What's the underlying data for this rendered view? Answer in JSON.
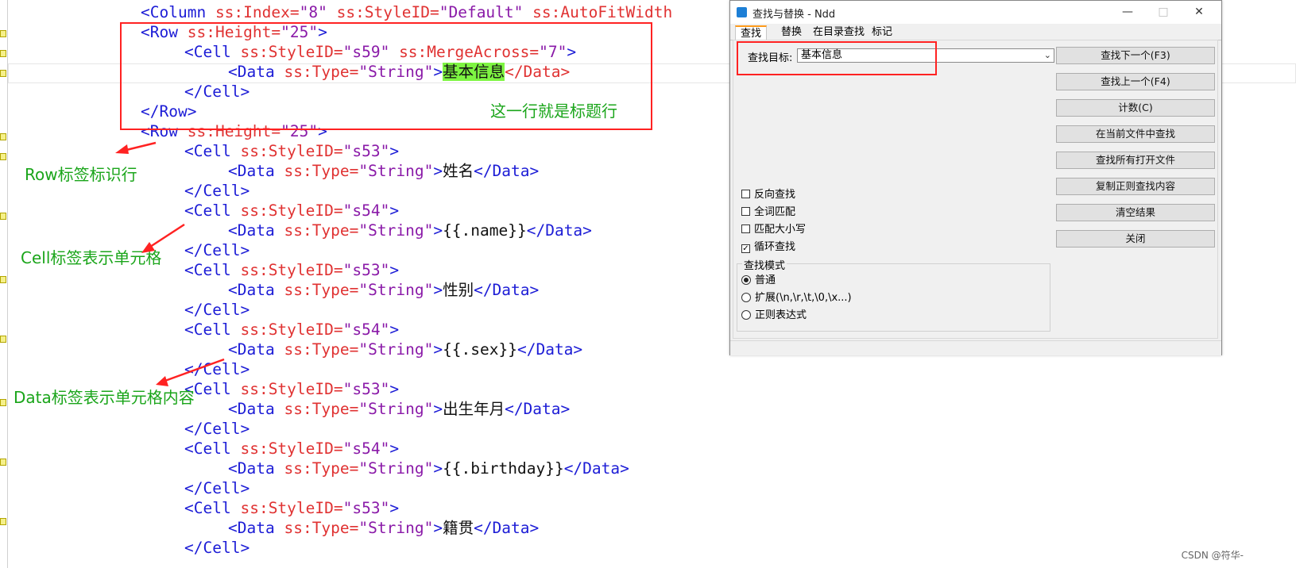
{
  "code": {
    "l1": {
      "open": "<",
      "tag": "Column",
      "a1": " ss:Index=",
      "v1": "\"8\"",
      "a2": " ss:StyleID=",
      "v2": "\"Default\"",
      "a3": " ss:AutoFitWidth",
      "rest": ""
    },
    "l2": {
      "tag": "Row",
      "attr": "ss:Height=",
      "val": "\"25\""
    },
    "l3": {
      "tag": "Cell",
      "a1": "ss:StyleID=",
      "v1": "\"s59\"",
      "a2": "ss:MergeAcross=",
      "v2": "\"7\""
    },
    "l4": {
      "tag": "Data",
      "attr": "ss:Type=",
      "val": "\"String\"",
      "content": "基本信息",
      "close": "</Data>"
    },
    "l5": {
      "close": "</Cell>"
    },
    "l6": {
      "close": "</Row>"
    },
    "l7": {
      "tag": "Row",
      "attr": "ss:Height=",
      "val": "\"25\""
    },
    "l8": {
      "tag": "Cell",
      "attr": "ss:StyleID=",
      "val": "\"s53\""
    },
    "l9": {
      "tag": "Data",
      "attr": "ss:Type=",
      "val": "\"String\"",
      "content": "姓名",
      "close": "</Data>"
    },
    "l10": {
      "close": "</Cell>"
    },
    "l11": {
      "tag": "Cell",
      "attr": "ss:StyleID=",
      "val": "\"s54\""
    },
    "l12": {
      "tag": "Data",
      "attr": "ss:Type=",
      "val": "\"String\"",
      "content": "{{.name}}",
      "close": "</Data>"
    },
    "l13": {
      "close": "</Cell>"
    },
    "l14": {
      "tag": "Cell",
      "attr": "ss:StyleID=",
      "val": "\"s53\""
    },
    "l15": {
      "tag": "Data",
      "attr": "ss:Type=",
      "val": "\"String\"",
      "content": "性别",
      "close": "</Data>"
    },
    "l16": {
      "close": "</Cell>"
    },
    "l17": {
      "tag": "Cell",
      "attr": "ss:StyleID=",
      "val": "\"s54\""
    },
    "l18": {
      "tag": "Data",
      "attr": "ss:Type=",
      "val": "\"String\"",
      "content": "{{.sex}}",
      "close": "</Data>"
    },
    "l19": {
      "close": "</Cell>"
    },
    "l20": {
      "tag": "Cell",
      "attr": "ss:StyleID=",
      "val": "\"s53\""
    },
    "l21": {
      "tag": "Data",
      "attr": "ss:Type=",
      "val": "\"String\"",
      "content": "出生年月",
      "close": "</Data>"
    },
    "l22": {
      "close": "</Cell>"
    },
    "l23": {
      "tag": "Cell",
      "attr": "ss:StyleID=",
      "val": "\"s54\""
    },
    "l24": {
      "tag": "Data",
      "attr": "ss:Type=",
      "val": "\"String\"",
      "content": "{{.birthday}}",
      "close": "</Data>"
    },
    "l25": {
      "close": "</Cell>"
    },
    "l26": {
      "tag": "Cell",
      "attr": "ss:StyleID=",
      "val": "\"s53\""
    },
    "l27": {
      "tag": "Data",
      "attr": "ss:Type=",
      "val": "\"String\"",
      "content": "籍贯",
      "close": "</Data>"
    },
    "l28": {
      "close": "</Cell>"
    }
  },
  "annotations": {
    "title_row": "这一行就是标题行",
    "row_tag": "Row标签标识行",
    "cell_tag": "Cell标签表示单元格",
    "data_tag": "Data标签表示单元格内容"
  },
  "colors": {
    "annotation_text": "#1aa51a",
    "annotation_box": "#ff2222",
    "xml_tag": "#1c1cd6",
    "xml_attr": "#e03232",
    "xml_value": "#8a1aa8",
    "match_highlight": "#7ef542"
  },
  "dialog": {
    "title": "查找与替换 - Ndd",
    "minimize": "—",
    "maximize": "□",
    "close": "✕",
    "tabs": [
      "查找",
      "替换",
      "在目录查找",
      "标记"
    ],
    "target_label": "查找目标:",
    "target_value": "基本信息",
    "buttons": [
      "查找下一个(F3)",
      "查找上一个(F4)",
      "计数(C)",
      "在当前文件中查找",
      "查找所有打开文件",
      "复制正则查找内容",
      "清空结果",
      "关闭"
    ],
    "options": [
      {
        "label": "反向查找",
        "checked": false
      },
      {
        "label": "全词匹配",
        "checked": false
      },
      {
        "label": "匹配大小写",
        "checked": false
      },
      {
        "label": "循环查找",
        "checked": true
      }
    ],
    "mode_title": "查找模式",
    "modes": [
      {
        "label": "普通",
        "selected": true
      },
      {
        "label": "扩展(\\n,\\r,\\t,\\0,\\x...)",
        "selected": false
      },
      {
        "label": "正则表达式",
        "selected": false
      }
    ]
  },
  "watermark": "CSDN @符华-"
}
